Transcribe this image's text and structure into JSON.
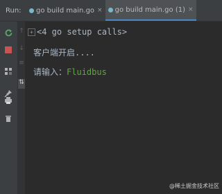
{
  "run_label": "Run:",
  "tabs": [
    {
      "label": "go build main.go",
      "close": "×",
      "active": false
    },
    {
      "label": "go build main.go (1)",
      "close": "×",
      "active": true
    }
  ],
  "toolbar_left_icons": [
    "rerun-icon",
    "stop-icon",
    "layout-icon",
    "pin-icon",
    "print-icon",
    "trash-icon"
  ],
  "toolbar_mid_icons": [
    "up-icon",
    "down-icon",
    "soft-wrap-icon",
    "sort-icon"
  ],
  "console": {
    "fold_marker": "+",
    "setup_calls": "<4 go setup calls>",
    "line1": "客户端开启....",
    "prompt": "请输入：",
    "input_value": "Fluidbus"
  },
  "watermark": "@稀土掘金技术社区",
  "colors": {
    "input_green": "#62a543",
    "stop_red": "#c75450",
    "rerun_green": "#59a869"
  }
}
